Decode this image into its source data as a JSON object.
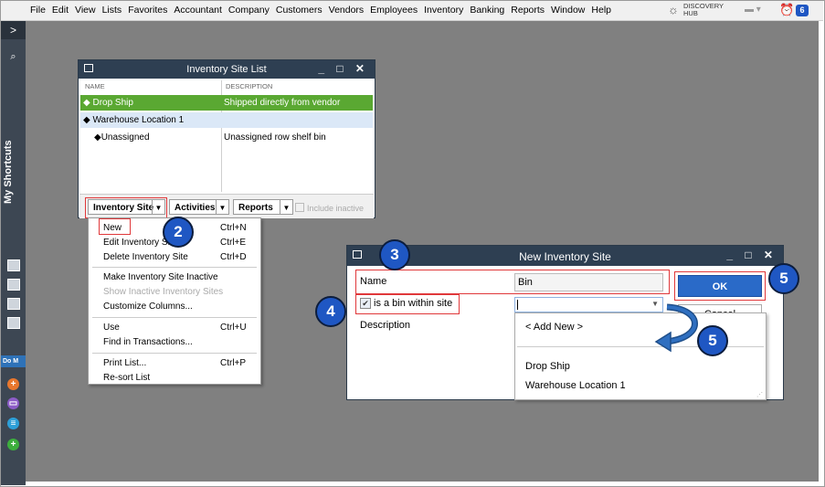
{
  "menubar": {
    "items": [
      "File",
      "Edit",
      "View",
      "Lists",
      "Favorites",
      "Accountant",
      "Company",
      "Customers",
      "Vendors",
      "Employees",
      "Inventory",
      "Banking",
      "Reports",
      "Window",
      "Help"
    ],
    "discovery_line1": "DISCOVERY",
    "discovery_line2": "HUB",
    "notification_count": "6"
  },
  "sidebar": {
    "expand_glyph": ">",
    "label": "My Shortcuts",
    "do_more": "Do M"
  },
  "inventory_site_list": {
    "title": "Inventory Site List",
    "columns": [
      "NAME",
      "DESCRIPTION"
    ],
    "rows": [
      {
        "name": "Drop Ship",
        "description": "Shipped directly from vendor"
      },
      {
        "name": "Warehouse Location 1",
        "description": ""
      },
      {
        "name": "Unassigned",
        "description": "Unassigned row shelf bin"
      }
    ],
    "buttons": {
      "inventory_site": "Inventory Site",
      "activities": "Activities",
      "reports": "Reports"
    },
    "include_inactive": "Include inactive"
  },
  "inventory_site_menu": {
    "items": [
      {
        "label": "New",
        "shortcut": "Ctrl+N"
      },
      {
        "label": "Edit Inventory Site",
        "shortcut": "Ctrl+E"
      },
      {
        "label": "Delete Inventory Site",
        "shortcut": "Ctrl+D"
      },
      {
        "label": "Make Inventory Site Inactive",
        "shortcut": ""
      },
      {
        "label": "Show Inactive Inventory Sites",
        "shortcut": ""
      },
      {
        "label": "Customize Columns...",
        "shortcut": ""
      },
      {
        "label": "Use",
        "shortcut": "Ctrl+U"
      },
      {
        "label": "Find in Transactions...",
        "shortcut": ""
      },
      {
        "label": "Print List...",
        "shortcut": "Ctrl+P"
      },
      {
        "label": "Re-sort List",
        "shortcut": ""
      }
    ]
  },
  "new_inventory_site": {
    "title": "New Inventory Site",
    "name_label": "Name",
    "name_value": "Bin",
    "bin_label": "is a bin within site",
    "description_label": "Description",
    "ok": "OK",
    "cancel": "Cancel",
    "dropdown_items": [
      "< Add New >",
      "Drop Ship",
      "Warehouse Location 1"
    ]
  },
  "callouts": {
    "step2": "2",
    "step3": "3",
    "step4": "4",
    "step5a": "5",
    "step5b": "5"
  },
  "colors": {
    "highlight_green": "#5aa832",
    "callout_blue": "#1f57c3",
    "red_box": "#e0383a",
    "title_bar": "#2e3f52"
  }
}
